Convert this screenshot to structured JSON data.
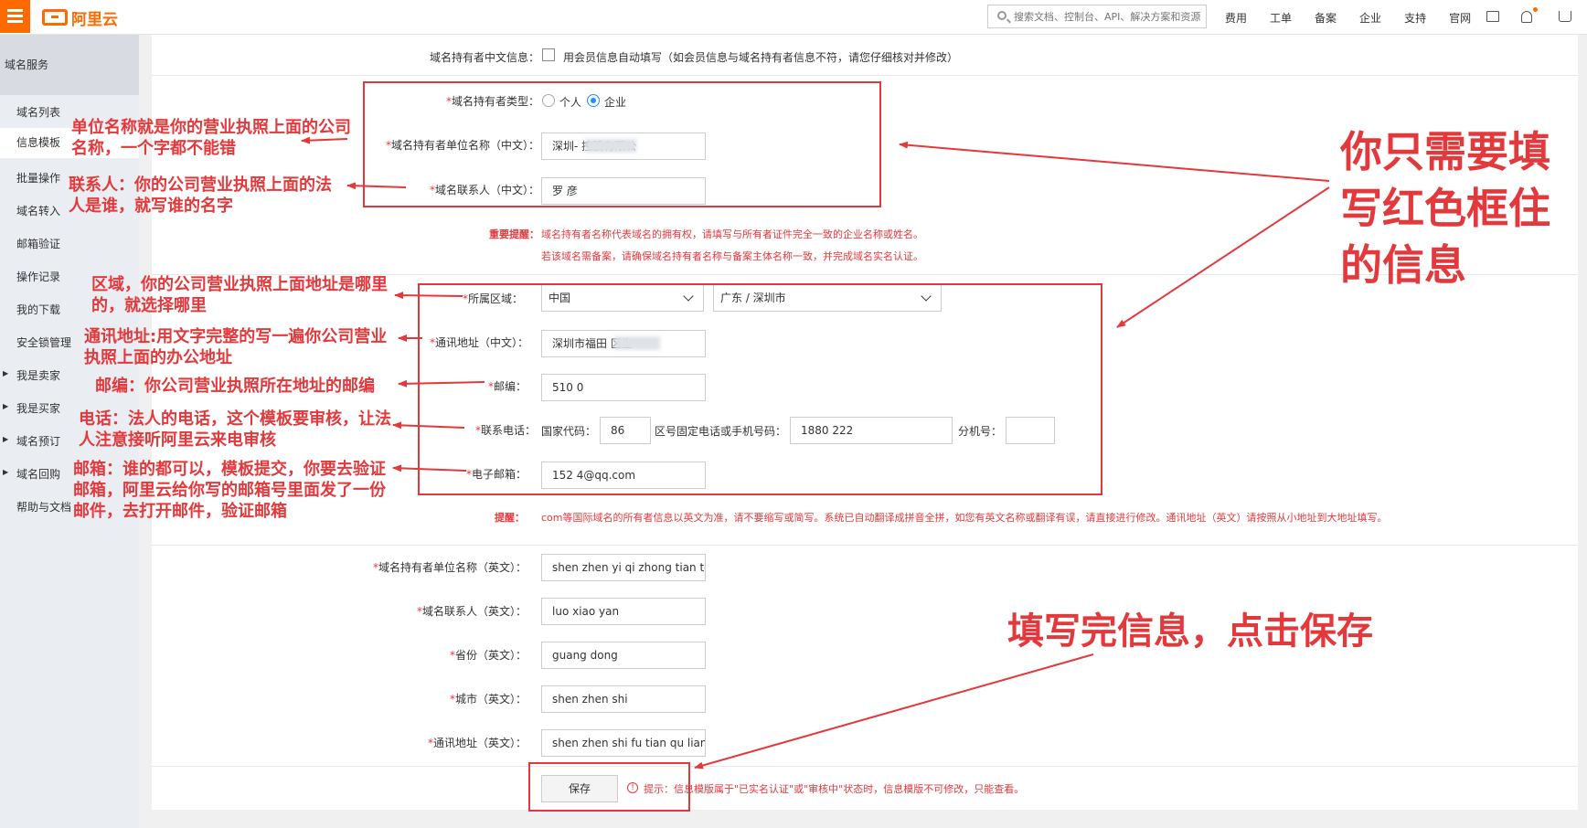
{
  "topbar": {
    "logo_text": "阿里云",
    "search_placeholder": "搜索文档、控制台、API、解决方案和资源",
    "nav": [
      "费用",
      "工单",
      "备案",
      "企业",
      "支持",
      "官网"
    ],
    "icons": [
      "menu-icon",
      "terminal-icon",
      "bell-icon",
      "cart-icon"
    ]
  },
  "sidebar": {
    "title": "域名服务",
    "items": [
      "域名列表",
      "信息模板",
      "批量操作",
      "域名转入",
      "邮箱验证",
      "操作记录",
      "我的下载",
      "安全锁管理",
      "我是卖家",
      "我是买家",
      "域名预订",
      "域名回购",
      "帮助与文档"
    ],
    "active": "信息模板"
  },
  "form": {
    "cn_info_label": "域名持有者中文信息：",
    "auto_fill_text": "用会员信息自动填写（如会员信息与域名持有者信息不符，请您仔细核对并修改）",
    "holder_type_label": "域名持有者类型：",
    "holder_type_personal": "个人",
    "holder_type_company": "企业",
    "company_cn_label": "域名持有者单位名称（中文）：",
    "company_cn_value": "深圳-        控股有限公",
    "contact_cn_label": "域名联系人（中文）：",
    "contact_cn_value": "罗   彦",
    "notice_label": "重要提醒：",
    "notice_line1": "域名持有者名称代表域名的拥有权，请填写与所有者证件完全一致的企业名称或姓名。",
    "notice_line2": "若该域名需备案，请确保域名持有者名称与备案主体名称一致，并完成域名实名认证。",
    "region_label": "所属区域：",
    "region_country": "中国",
    "region_city": "广东 / 深圳市",
    "address_cn_label": "通讯地址（中文）：",
    "address_cn_value": "深圳市福田       区生",
    "postcode_label": "邮编：",
    "postcode_value": "510  0",
    "phone_label": "联系电话：",
    "country_code_label": "国家代码：",
    "country_code_value": "86",
    "phone_number_label": "区号固定电话或手机号码：",
    "phone_number_value": "1880    222",
    "extension_label": "分机号：",
    "extension_value": "",
    "email_label": "电子邮箱：",
    "email_value": "152     4@qq.com",
    "tip_label": "提醒：",
    "tip_text": "com等国际域名的所有者信息以英文为准，请不要缩写或简写。系统已自动翻译成拼音全拼，如您有英文名称或翻译有误，请直接进行修改。通讯地址（英文）请按照从小地址到大地址填写。",
    "company_en_label": "域名持有者单位名称（英文）：",
    "company_en_value": "shen zhen yi qi zhong tian tou",
    "contact_en_label": "域名联系人（英文）：",
    "contact_en_value": "luo xiao yan",
    "province_en_label": "省份（英文）：",
    "province_en_value": "guang dong",
    "city_en_label": "城市（英文）：",
    "city_en_value": "shen zhen shi",
    "address_en_label": "通讯地址（英文）：",
    "address_en_value": "shen zhen shi fu tian qu lian h",
    "save_label": "保存",
    "save_hint": "提示：信息模版属于\"已实名认证\"或\"审核中\"状态时，信息模版不可修改，只能查看。"
  },
  "annotations": {
    "company_name": "单位名称就是你的营业执照上面的公司名称，一个字都不能错",
    "contact": "联系人：你的公司营业执照上面的法人是谁，就写谁的名字",
    "region": "区域，你的公司营业执照上面地址是哪里的，就选择哪里",
    "address": "通讯地址:用文字完整的写一遍你公司营业执照上面的办公地址",
    "postcode": "邮编：你公司营业执照所在地址的邮编",
    "phone": "电话：法人的电话，这个模板要审核，让法人注意接听阿里云来电审核",
    "email": "邮箱：谁的都可以，模板提交，你要去验证邮箱，阿里云给你写的邮箱号里面发了一份邮件，去打开邮件，验证邮箱",
    "big_note": "你只需要填写红色框住的信息",
    "save_note": "填写完信息，点击保存",
    "color": "#e4393c"
  }
}
